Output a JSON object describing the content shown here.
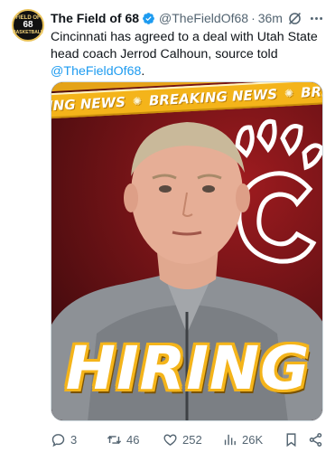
{
  "author": {
    "display_name": "The Field of 68",
    "handle": "@TheFieldOf68",
    "separator": "·",
    "time": "36m",
    "verified": true,
    "avatar_text": {
      "top": "FIELD OF",
      "middle": "68",
      "bottom": "BASKETBALL"
    }
  },
  "tweet": {
    "text": "Cincinnati has agreed to a deal with Utah State head coach Jerrod Calhoun, source told ",
    "mention": "@TheFieldOf68",
    "end_punct": "."
  },
  "media": {
    "banner_text": [
      "ING NEWS",
      "BREAKING NEWS",
      "BREAKING N"
    ],
    "headline": "HIRING",
    "colors": {
      "accent": "#f4b41a",
      "background": "#8a1a1d"
    }
  },
  "actions": {
    "replies": "3",
    "retweets": "46",
    "likes": "252",
    "views": "26K"
  },
  "icons": {
    "verified": "verified-badge-icon",
    "grok": "grok-icon",
    "more": "more-icon",
    "reply": "reply-icon",
    "retweet": "retweet-icon",
    "like": "heart-icon",
    "views": "views-icon",
    "bookmark": "bookmark-icon",
    "share": "share-icon"
  }
}
